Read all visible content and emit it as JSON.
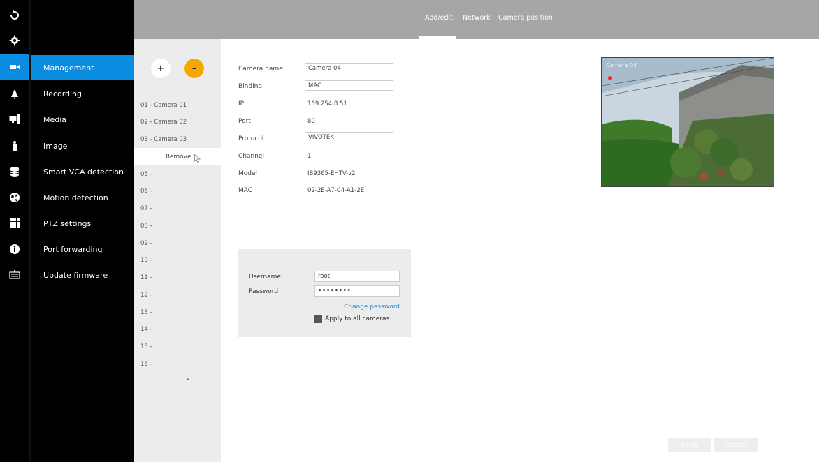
{
  "topbar": {
    "tabs": [
      {
        "label": "Add/edit",
        "active": true
      },
      {
        "label": "Network",
        "active": false
      },
      {
        "label": "Camera position",
        "active": false
      }
    ]
  },
  "iconbar": {
    "icons": [
      "logout-icon",
      "gear-icon",
      "camera-icon",
      "bell-icon",
      "monitor-icon",
      "person-icon",
      "database-icon",
      "globe-icon",
      "grid-icon",
      "info-icon",
      "keyboard-icon"
    ],
    "active_index": 2
  },
  "menu": {
    "items": [
      {
        "label": "Management",
        "active": true
      },
      {
        "label": "Recording",
        "active": false
      },
      {
        "label": "Media",
        "active": false
      },
      {
        "label": "Image",
        "active": false
      },
      {
        "label": "Smart VCA detection",
        "active": false
      },
      {
        "label": "Motion detection",
        "active": false
      },
      {
        "label": "PTZ settings",
        "active": false
      },
      {
        "label": "Port forwarding",
        "active": false
      },
      {
        "label": "Update firmware",
        "active": false
      }
    ]
  },
  "camlist": {
    "add_label": "+",
    "remove_symbol": "–",
    "rows": [
      "01 - Camera 01",
      "02 - Camera 02",
      "03 - Camera 03",
      "05 -",
      "06 -",
      "07 -",
      "08 -",
      "09 -",
      "10 -",
      "11 -",
      "12 -",
      "13 -",
      "14 -",
      "15 -",
      "16 -"
    ],
    "context_menu": {
      "remove_label": "Remove"
    },
    "pager": [
      "-",
      "•"
    ]
  },
  "form": {
    "camera_name": {
      "label": "Camera name",
      "value": "Camera 04"
    },
    "binding": {
      "label": "Binding",
      "value": "MAC"
    },
    "ip": {
      "label": "IP",
      "value": "169.254.8.51"
    },
    "port": {
      "label": "Port",
      "value": "80"
    },
    "protocol": {
      "label": "Protocol",
      "value": "VIVOTEK"
    },
    "channel": {
      "label": "Channel",
      "value": "1"
    },
    "model": {
      "label": "Model",
      "value": "IB9365-EHTV-v2"
    },
    "mac": {
      "label": "MAC",
      "value": "02-2E-A7-C4-A1-2E"
    }
  },
  "preview": {
    "overlay_text": "Camera 04",
    "rec_color": "#ff2222"
  },
  "credentials": {
    "username_label": "Username",
    "username_value": "root",
    "password_label": "Password",
    "password_value": "••••••••",
    "change_password_label": "Change password",
    "apply_all_label": "Apply to all cameras"
  },
  "footer": {
    "apply_label": "Apply",
    "cancel_label": "Cancel"
  },
  "colors": {
    "accent": "#0a8de0",
    "minus_button": "#f7a800",
    "topbar": "#a6a6a6",
    "link": "#1e8fdc"
  }
}
